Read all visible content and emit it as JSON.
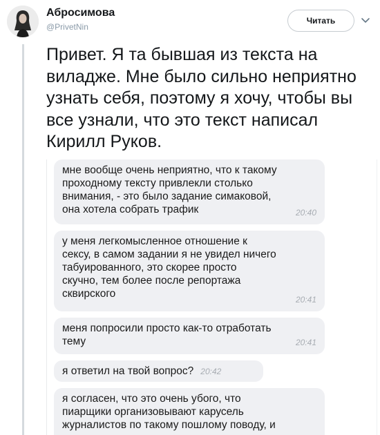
{
  "author": {
    "name": "Абросимова",
    "handle": "@PrivetNin"
  },
  "follow_button": {
    "label": "Читать"
  },
  "icons": {
    "avatar": "profile-photo",
    "menu": "chevron-down-icon"
  },
  "tweet": {
    "text": "Привет. Я та бывшая из текста на виладже. Мне было сильно неприятно узнать себя, поэтому я хочу, чтобы вы все узнали, что это текст написал Кирилл Руков."
  },
  "chat": {
    "messages": [
      {
        "text": "мне вообще очень неприятно, что к такому\nпроходному тексту привлекли столько\nвнимания, - это было задание симаковой,\nона хотела собрать трафик",
        "time": "20:40"
      },
      {
        "text": "у меня легкомысленное отношение к\nсексу, в самом задании я не увидел ничего\nтабуированного, это скорее просто\nскучно, тем более после репортажа\nсквирского",
        "time": "20:41"
      },
      {
        "text": "меня попросили просто как-то отработать\nтему",
        "time": "20:41"
      },
      {
        "text": "я ответил на твой вопрос?",
        "time": "20:42"
      },
      {
        "text": "я согласен, что это очень убого, что\nпиарщики организовывают карусель\nжурналистов по такому пошлому поводу, и",
        "time": ""
      }
    ]
  },
  "colors": {
    "bubble_bg": "#eff0f3",
    "thread_line": "#d5dade",
    "handle": "#8a9aa8",
    "timestamp": "#a8adb3"
  }
}
